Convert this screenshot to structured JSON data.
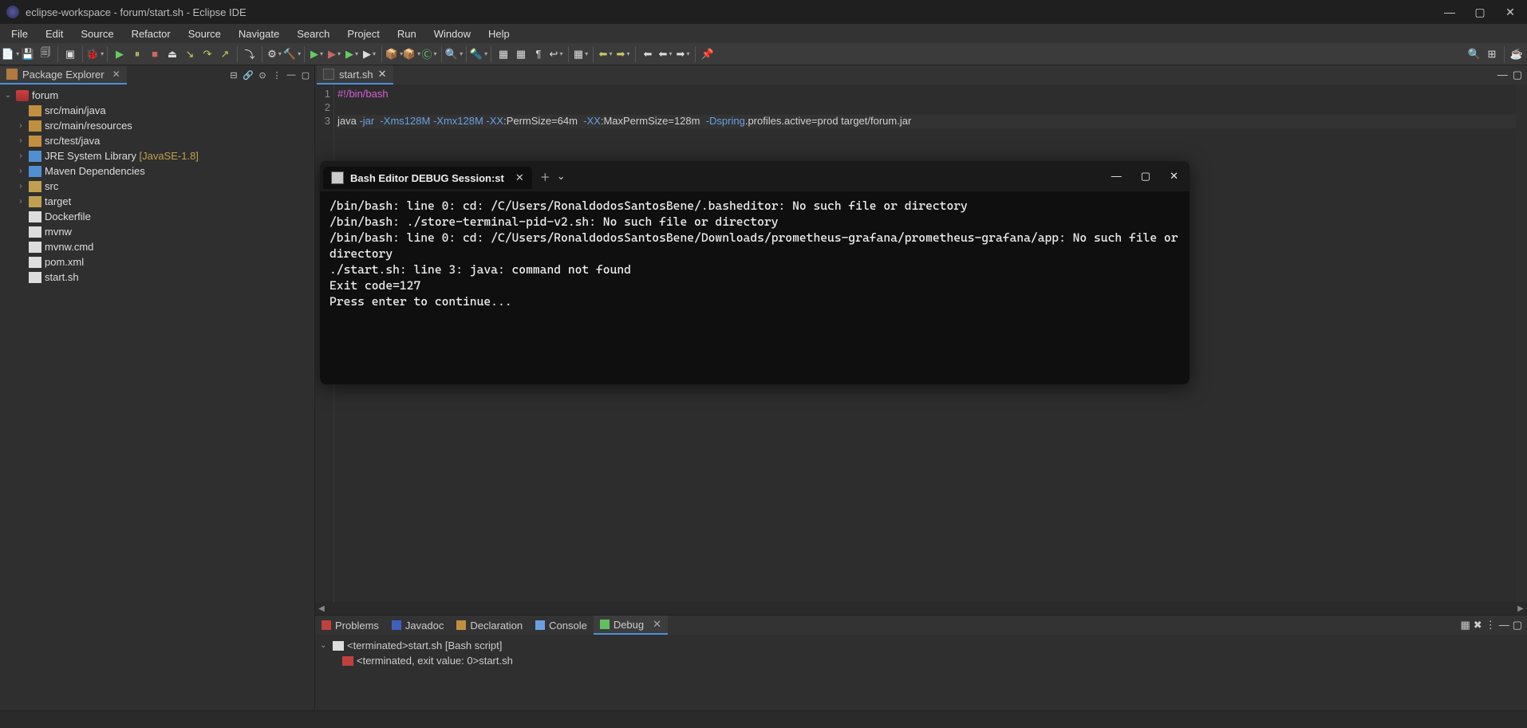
{
  "window": {
    "title": "eclipse-workspace - forum/start.sh - Eclipse IDE"
  },
  "menubar": [
    "File",
    "Edit",
    "Source",
    "Refactor",
    "Source",
    "Navigate",
    "Search",
    "Project",
    "Run",
    "Window",
    "Help"
  ],
  "sidebar": {
    "view_title": "Package Explorer",
    "tree": {
      "project": "forum",
      "items": [
        {
          "label": "src/main/java",
          "icon": "icon-pkg",
          "expand": ""
        },
        {
          "label": "src/main/resources",
          "icon": "icon-pkg",
          "expand": "›"
        },
        {
          "label": "src/test/java",
          "icon": "icon-pkg",
          "expand": "›"
        },
        {
          "label": "JRE System Library",
          "extra": " [JavaSE-1.8]",
          "icon": "icon-jar",
          "expand": "›"
        },
        {
          "label": "Maven Dependencies",
          "icon": "icon-jar",
          "expand": "›"
        },
        {
          "label": "src",
          "icon": "icon-folder",
          "expand": "›"
        },
        {
          "label": "target",
          "icon": "icon-folder",
          "expand": "›"
        },
        {
          "label": "Dockerfile",
          "icon": "icon-file",
          "expand": ""
        },
        {
          "label": "mvnw",
          "icon": "icon-file",
          "expand": ""
        },
        {
          "label": "mvnw.cmd",
          "icon": "icon-file",
          "expand": ""
        },
        {
          "label": "pom.xml",
          "icon": "icon-file",
          "expand": ""
        },
        {
          "label": "start.sh",
          "icon": "icon-file",
          "expand": ""
        }
      ]
    }
  },
  "editor": {
    "tab_label": "start.sh",
    "code": {
      "line1_shebang": "#!/bin/bash",
      "line3_pre": "java ",
      "line3_jar": "-jar",
      "line3_xms": "  -Xms128M",
      "line3_xmx": " -Xmx128M",
      "line3_xx1": " -XX",
      "line3_perm": ":PermSize=64m ",
      "line3_xx2": " -XX",
      "line3_maxperm": ":MaxPermSize=128m ",
      "line3_spring": " -Dspring",
      "line3_rest": ".profiles.active=prod target/forum.jar"
    }
  },
  "terminal": {
    "tab_title": "Bash Editor DEBUG Session:st",
    "output": "/bin/bash: line 0: cd: /C/Users/RonaldodosSantosBene/.basheditor: No such file or directory\n/bin/bash: ./store-terminal-pid-v2.sh: No such file or directory\n/bin/bash: line 0: cd: /C/Users/RonaldodosSantosBene/Downloads/prometheus-grafana/prometheus-grafana/app: No such file or directory\n./start.sh: line 3: java: command not found\nExit code=127\nPress enter to continue..."
  },
  "bottom_panel": {
    "tabs": [
      "Problems",
      "Javadoc",
      "Declaration",
      "Console",
      "Debug"
    ],
    "debug": {
      "root": "<terminated>start.sh [Bash script]",
      "child": "<terminated, exit value: 0>start.sh"
    }
  }
}
